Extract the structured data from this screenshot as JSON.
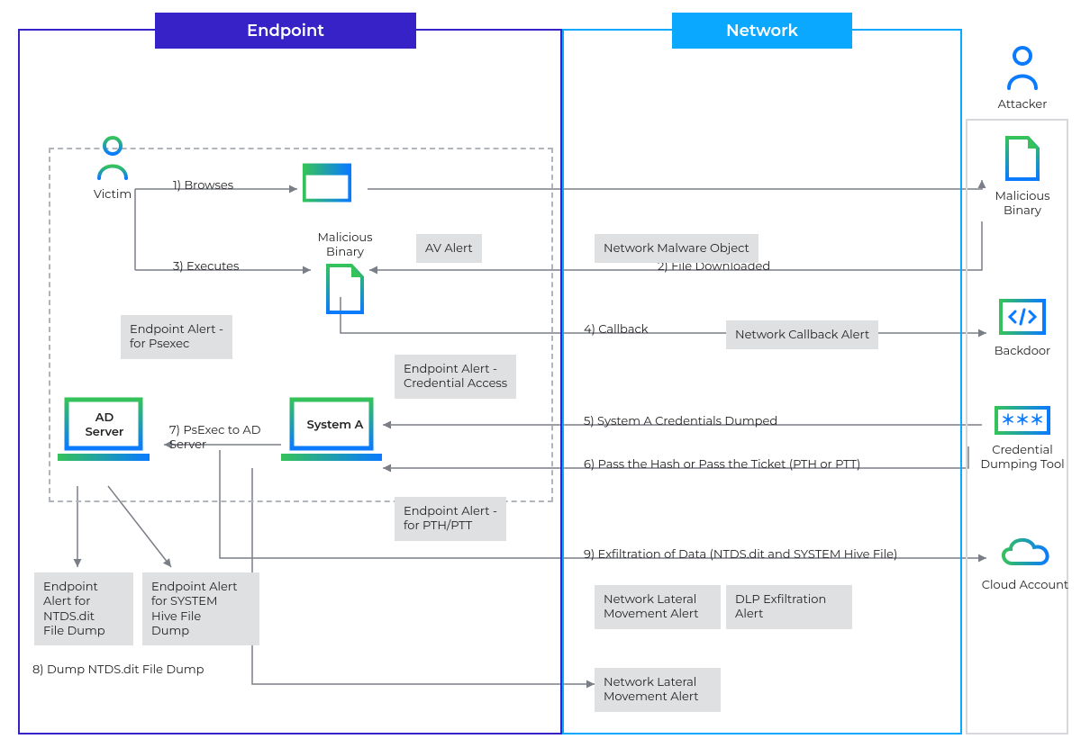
{
  "panels": {
    "endpoint": "Endpoint",
    "network": "Network"
  },
  "nodes": {
    "victim": "Victim",
    "attacker": "Attacker",
    "malbin": "Malicious\nBinary",
    "malbin_side": "Malicious\nBinary",
    "backdoor": "Backdoor",
    "credtool": "Credential\nDumping Tool",
    "cloud": "Cloud Account",
    "ad": "AD\nServer",
    "sysa": "System A"
  },
  "steps": {
    "s1": "1) Browses",
    "s2": "2) File Downloaded",
    "s3": "3) Executes",
    "s4": "4) Callback",
    "s5": "5) System A Credentials Dumped",
    "s6": "6) Pass the Hash or Pass the Ticket (PTH or PTT)",
    "s7": "7) PsExec to AD Server",
    "s8": "8) Dump NTDS.dit File Dump",
    "s9": "9) Exfiltration of Data (NTDS.dit and SYSTEM Hive File)"
  },
  "alerts": {
    "av": "AV Alert",
    "nmw": "Network Malware Object",
    "ncb": "Network Callback Alert",
    "eps": "Endpoint Alert -\nfor Psexec",
    "cred": "Endpoint Alert -\nCredential Access",
    "pth": "Endpoint Alert -\nfor PTH/PTT",
    "ntds": "Endpoint\nAlert for\nNTDS.dit\nFile Dump",
    "hive": "Endpoint Alert\nfor SYSTEM\nHive File\nDump",
    "lat1": "Network Lateral\nMovement Alert",
    "dlp": "DLP Exfiltration\nAlert",
    "lat2": "Network Lateral\nMovement Alert"
  }
}
